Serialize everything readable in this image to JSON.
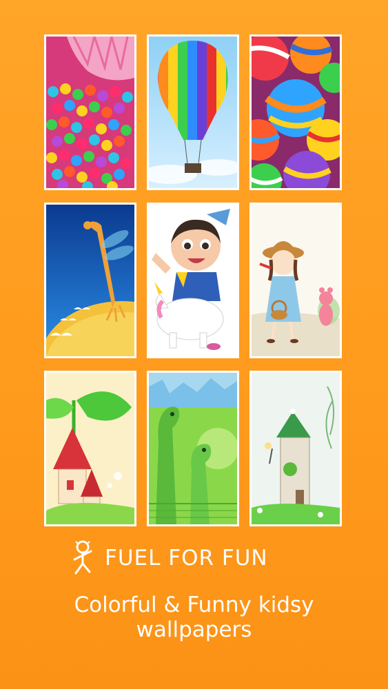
{
  "brand": {
    "title": "FUEL FOR FUN",
    "logo_icon": "kid-running-icon"
  },
  "tagline": {
    "line1": "Colorful & Funny kidsy",
    "line2": "wallpapers"
  },
  "wallpapers": [
    {
      "id": "candy",
      "icon": "candy-wallpaper"
    },
    {
      "id": "balloon",
      "icon": "hot-air-balloon-wallpaper"
    },
    {
      "id": "balls",
      "icon": "striped-balls-wallpaper"
    },
    {
      "id": "giraffe",
      "icon": "giraffe-wallpaper"
    },
    {
      "id": "girl-unicorn",
      "icon": "girl-unicorn-wallpaper"
    },
    {
      "id": "girl-basket",
      "icon": "girl-basket-wallpaper"
    },
    {
      "id": "mushroom-house",
      "icon": "mushroom-house-wallpaper"
    },
    {
      "id": "dinosaurs",
      "icon": "dinosaurs-wallpaper"
    },
    {
      "id": "tower",
      "icon": "fairy-tower-wallpaper"
    }
  ],
  "colors": {
    "background": "#ff9e22",
    "tile_border": "#ffffff",
    "text": "#ffffff"
  }
}
